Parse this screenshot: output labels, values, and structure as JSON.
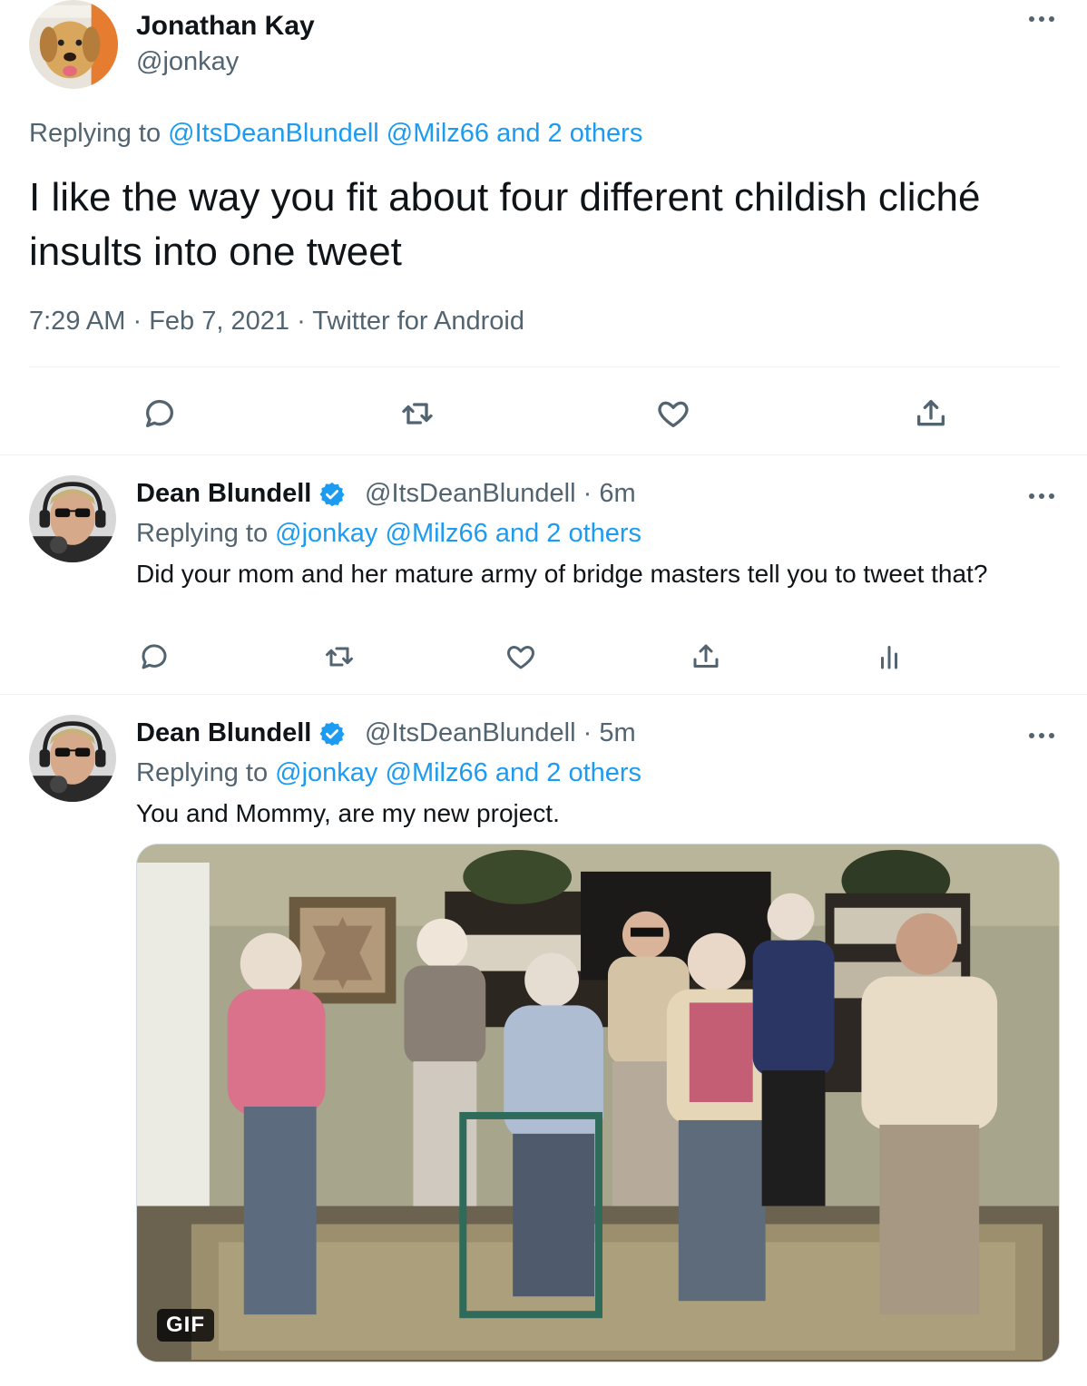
{
  "main_tweet": {
    "name": "Jonathan Kay",
    "handle": "@jonkay",
    "replying_prefix": "Replying to ",
    "replying_to_1": "@ItsDeanBlundell",
    "replying_to_2": "@Milz66",
    "replying_others": "and 2 others",
    "text": "I like the way you fit about four different childish cliché insults into one tweet",
    "time": "7:29 AM",
    "date": "Feb 7, 2021",
    "source": "Twitter for Android",
    "separator": "·",
    "avatar_icon": "dog-avatar-icon"
  },
  "replies": [
    {
      "name": "Dean Blundell",
      "verified": true,
      "handle": "@ItsDeanBlundell",
      "age": "6m",
      "replying_prefix": "Replying to ",
      "replying_to_1": "@jonkay",
      "replying_to_2": "@Milz66",
      "replying_others": "and 2 others",
      "text": "Did your mom and her mature army of bridge masters tell you to tweet that?"
    },
    {
      "name": "Dean Blundell",
      "verified": true,
      "handle": "@ItsDeanBlundell",
      "age": "5m",
      "replying_prefix": "Replying to ",
      "replying_to_1": "@jonkay",
      "replying_to_2": "@Milz66",
      "replying_others": "and 2 others",
      "text": "You and Mommy, are my new project.",
      "media_badge": "GIF"
    }
  ],
  "colors": {
    "link": "#1d9bf0",
    "muted": "#536471",
    "text": "#0f1419",
    "verified": "#1d9bf0",
    "divider": "#eff3f4"
  }
}
